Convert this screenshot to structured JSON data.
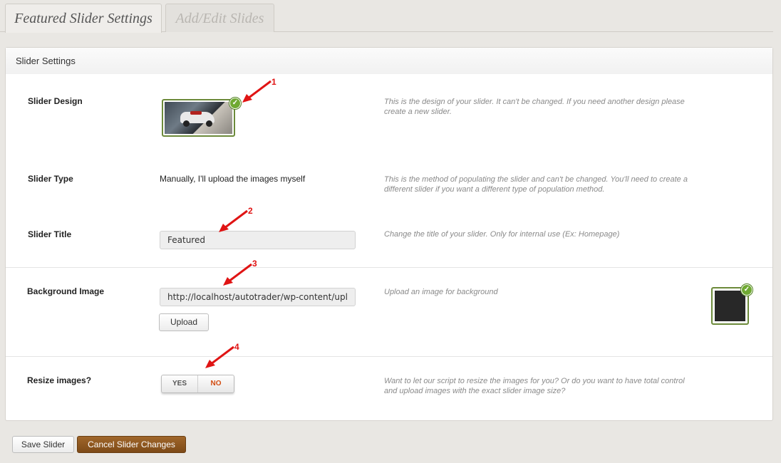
{
  "tabs": [
    {
      "label": "Featured Slider Settings",
      "active": true
    },
    {
      "label": "Add/Edit Slides",
      "active": false
    }
  ],
  "panel": {
    "title": "Slider Settings",
    "rows": {
      "design": {
        "label": "Slider Design",
        "help": "This is the design of your slider. It can't be changed. If you need another design please create a new slider."
      },
      "type": {
        "label": "Slider Type",
        "value": "Manually, I'll upload the images myself",
        "help": "This is the method of populating the slider and can't be changed. You'll need to create a different slider if you want a different type of population method."
      },
      "title": {
        "label": "Slider Title",
        "value": "Featured",
        "help": "Change the title of your slider. Only for internal use (Ex: Homepage)"
      },
      "background": {
        "label": "Background Image",
        "value": "http://localhost/autotrader/wp-content/upl",
        "upload_label": "Upload",
        "help": "Upload an image for background",
        "swatch_color": "#282828"
      },
      "resize": {
        "label": "Resize images?",
        "yes_label": "YES",
        "no_label": "NO",
        "selected": "NO",
        "help": "Want to let our script to resize the images for you? Or do you want to have total control and upload images with the exact slider image size?"
      }
    }
  },
  "annotations": [
    "1",
    "2",
    "3",
    "4"
  ],
  "footer": {
    "save_label": "Save Slider",
    "cancel_label": "Cancel Slider Changes"
  },
  "colors": {
    "accent_red": "#e01414",
    "check_green": "#6fa932",
    "cancel_brown": "#8a5520",
    "no_orange": "#d24c11"
  }
}
